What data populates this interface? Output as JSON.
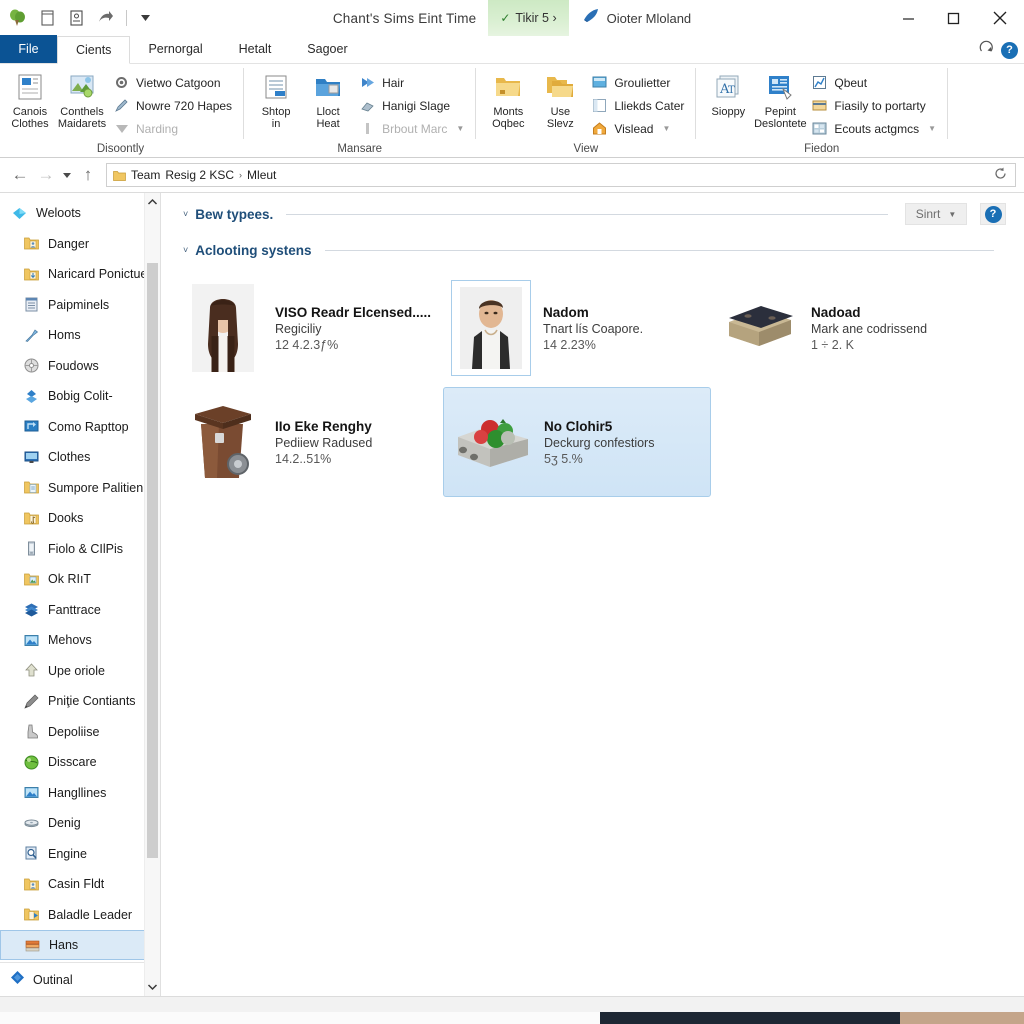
{
  "titlebar": {
    "quick_access": [
      "app-logo",
      "new-document-icon",
      "properties-icon",
      "share-icon",
      "customize-caret"
    ],
    "title": "Chant's Sims Eint Time",
    "chip_label": "Tikir 5 ›",
    "chip_check": "✓",
    "extra_label": "Oioter Mloland",
    "minimize": "—",
    "maximize": "□",
    "close": "✕"
  },
  "tabs": {
    "file_label": "File",
    "items": [
      {
        "label": "Cients",
        "active": true
      },
      {
        "label": "Pernorgal",
        "active": false
      },
      {
        "label": "Hetalt",
        "active": false
      },
      {
        "label": "Sagoer",
        "active": false
      }
    ],
    "help_label": "?",
    "collapse_caret": "∧"
  },
  "ribbon": {
    "groups": [
      {
        "name": "Disoontly",
        "label": "Disoontly",
        "big": [
          {
            "label_line1": "Canois",
            "label_line2": "Clothes",
            "icon": "document-preview-icon"
          },
          {
            "label_line1": "Conthels",
            "label_line2": "Maidarets",
            "icon": "picture-tools-icon"
          }
        ],
        "small": [
          {
            "label": "Vietwo Catgoon",
            "icon": "gear-cog-icon",
            "disabled": false,
            "dropdown": false
          },
          {
            "label": "Nowre 720 Hapes",
            "icon": "pen-icon",
            "disabled": false,
            "dropdown": false
          },
          {
            "label": "Narding",
            "icon": "caret-down-icon",
            "disabled": true,
            "dropdown": false
          }
        ]
      },
      {
        "name": "Mansare",
        "label": "Mansare",
        "big": [
          {
            "label_line1": "Shtop",
            "label_line2": "in",
            "icon": "clipboard-icon"
          },
          {
            "label_line1": "Lloct",
            "label_line2": "Heat",
            "icon": "blue-folder-icon"
          }
        ],
        "small": [
          {
            "label": "Hair",
            "icon": "blue-arrow-icon",
            "disabled": false,
            "dropdown": false
          },
          {
            "label": "Hanigi Slage",
            "icon": "eraser-icon",
            "disabled": false,
            "dropdown": false
          },
          {
            "label": "Brbout Marc",
            "icon": "column-icon",
            "disabled": true,
            "dropdown": true
          }
        ]
      },
      {
        "name": "View",
        "label": "View",
        "big": [
          {
            "label_line1": "Monts",
            "label_line2": "Oqbec",
            "icon": "yellow-folder-icon"
          },
          {
            "label_line1": "Use",
            "label_line2": "Slevz",
            "icon": "yellow-folders-icon"
          }
        ],
        "small": [
          {
            "label": "Groulietter",
            "icon": "monitor-icon",
            "disabled": false,
            "dropdown": false
          },
          {
            "label": "Lliekds Cater",
            "icon": "window-icon",
            "disabled": false,
            "dropdown": false
          },
          {
            "label": "Vislead",
            "icon": "home-icon",
            "disabled": false,
            "dropdown": true
          }
        ]
      },
      {
        "name": "Fiedon",
        "label": "Fiedon",
        "big": [
          {
            "label_line1": "Sioppy",
            "label_line2": "",
            "icon": "font-icon"
          },
          {
            "label_line1": "Pepint",
            "label_line2": "Deslontete",
            "icon": "form-edit-icon"
          }
        ],
        "small": [
          {
            "label": "Qbeut",
            "icon": "chart-icon",
            "disabled": false,
            "dropdown": false
          },
          {
            "label": "Fiasily to portarty",
            "icon": "card-icon",
            "disabled": false,
            "dropdown": false
          },
          {
            "label": "Ecouts actgmcs",
            "icon": "grid-icon",
            "disabled": false,
            "dropdown": true
          }
        ]
      }
    ]
  },
  "addressbar": {
    "back": "←",
    "forward": "→",
    "history_caret": "▾",
    "up": "↑",
    "crumbs": [
      "Team",
      "Resig 2 KSC",
      "Mleut"
    ],
    "separator": "›",
    "refresh": "↻"
  },
  "sidebar": {
    "items": [
      {
        "label": "Weloots",
        "icon": "favorites-diamond-icon",
        "root": true,
        "selected": false
      },
      {
        "label": "Danger",
        "icon": "folder-user-icon",
        "root": false,
        "selected": false
      },
      {
        "label": "Naricard Ponictuer",
        "icon": "folder-download-icon",
        "root": false,
        "selected": false
      },
      {
        "label": "Paipminels",
        "icon": "notes-icon",
        "root": false,
        "selected": false
      },
      {
        "label": "Homs",
        "icon": "wrench-icon",
        "root": false,
        "selected": false
      },
      {
        "label": "Foudows",
        "icon": "disc-icon",
        "root": false,
        "selected": false
      },
      {
        "label": "Bobig Colit-",
        "icon": "blue-star-icon",
        "root": false,
        "selected": false
      },
      {
        "label": "Como Rapttop",
        "icon": "screen-blue-icon",
        "root": false,
        "selected": false
      },
      {
        "label": "Clothes",
        "icon": "monitor-icon",
        "root": false,
        "selected": false
      },
      {
        "label": "Sumpore Palitienis",
        "icon": "folder-doc-icon",
        "root": false,
        "selected": false
      },
      {
        "label": "Dooks",
        "icon": "folder-music-icon",
        "root": false,
        "selected": false
      },
      {
        "label": "Fiolo & CIlPis",
        "icon": "device-icon",
        "root": false,
        "selected": false
      },
      {
        "label": "Ok RIıT",
        "icon": "folder-pic-icon",
        "root": false,
        "selected": false
      },
      {
        "label": "Fanttrace",
        "icon": "layers-icon",
        "root": false,
        "selected": false
      },
      {
        "label": "Mehovs",
        "icon": "picture-icon",
        "root": false,
        "selected": false
      },
      {
        "label": "Upe oriole",
        "icon": "upload-arrow-icon",
        "root": false,
        "selected": false
      },
      {
        "label": "Pniţie Contiants",
        "icon": "pen-dark-icon",
        "root": false,
        "selected": false
      },
      {
        "label": "Depoliise",
        "icon": "boot-icon",
        "root": false,
        "selected": false
      },
      {
        "label": "Disscare",
        "icon": "green-globe-icon",
        "root": false,
        "selected": false
      },
      {
        "label": "Hangllines",
        "icon": "picture-icon",
        "root": false,
        "selected": false
      },
      {
        "label": "Denig",
        "icon": "disc-flat-icon",
        "root": false,
        "selected": false
      },
      {
        "label": "Engine",
        "icon": "search-doc-icon",
        "root": false,
        "selected": false
      },
      {
        "label": "Casin Fldt",
        "icon": "folder-user-icon",
        "root": false,
        "selected": false
      },
      {
        "label": "Baladle Leader",
        "icon": "folder-share-icon",
        "root": false,
        "selected": false
      },
      {
        "label": "Hans",
        "icon": "books-icon",
        "root": false,
        "selected": true
      }
    ],
    "bottom_item": {
      "label": "Outinal",
      "icon": "blue-diamond-icon"
    },
    "scroll_up": "∧",
    "scroll_down": "∨"
  },
  "content": {
    "groups": [
      {
        "title": "Bew typees.",
        "chevron": "˅",
        "sort_label": "Sinrt",
        "sort_caret": "▾",
        "help_label": "?",
        "has_toolbar": true,
        "tiles": []
      },
      {
        "title": "Aclooting systens",
        "chevron": "˅",
        "has_toolbar": false,
        "tiles": [
          {
            "name": "VISO Readr Elcensed.....",
            "subtitle": "Regiciliy",
            "detail": "12 4.2.3ƒ%",
            "thumb": "woman-portrait-thumb",
            "selected": false,
            "framed": false
          },
          {
            "name": "Nadom",
            "subtitle": "Tnart lís Coapore.",
            "detail": "14 2.23%",
            "thumb": "man-portrait-thumb",
            "selected": false,
            "framed": true
          },
          {
            "name": "Nadoad",
            "subtitle": "Mark ane codrissend",
            "detail": "1 ÷ 2. K",
            "thumb": "bench-box-thumb",
            "selected": false,
            "framed": false
          },
          {
            "name": "IIo Eke Renghy",
            "subtitle": "Pediiew Radused",
            "detail": "14.2..51%",
            "thumb": "brown-bin-thumb",
            "selected": false,
            "framed": false
          },
          {
            "name": "No Clohir5",
            "subtitle": "Deckurg confestiors",
            "detail": "5ʒ 5.%",
            "thumb": "fruit-crate-thumb",
            "selected": true,
            "framed": false
          }
        ]
      }
    ]
  },
  "colors": {
    "accent": "#0b5394",
    "group_title": "#1f4e79",
    "selection": "#cfe4f6",
    "selection_border": "#a8cdea",
    "chip_green": "#cde9c4",
    "sidebar_sel": "#dbeaf7"
  }
}
